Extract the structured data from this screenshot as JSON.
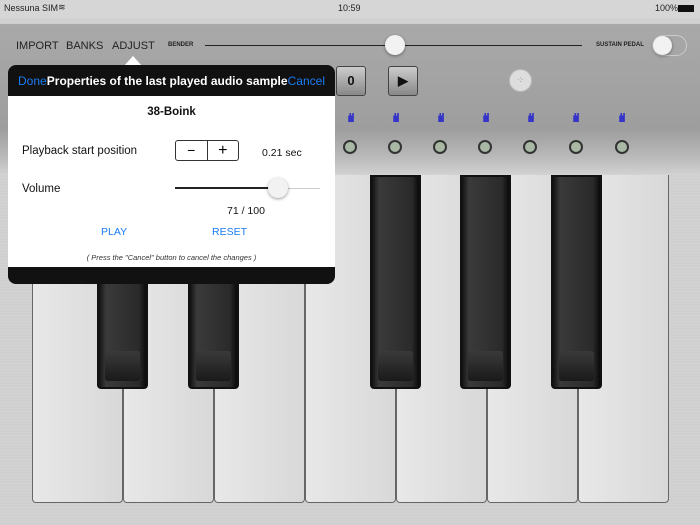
{
  "status": {
    "carrier": "Nessuna SIM",
    "time": "10:59",
    "battery": "100%"
  },
  "toolbar": {
    "import": "IMPORT",
    "banks": "BANKS",
    "adjust": "ADJUST",
    "bender": "BENDER",
    "sustain": "SUSTAIN PEDAL",
    "bender_value": 0.5,
    "sustain_on": false
  },
  "controls": {
    "counter": "0"
  },
  "popover": {
    "done": "Done",
    "title": "Properties of the last played audio sample",
    "cancel": "Cancel",
    "sample_name": "38-Boink",
    "playback_label": "Playback start position",
    "minus": "−",
    "plus": "+",
    "playback_value": "0.21 sec",
    "volume_label": "Volume",
    "volume_value": "71 / 100",
    "volume_fraction": 0.71,
    "play": "PLAY",
    "reset": "RESET",
    "hint": "( Press the \"Cancel\" button to cancel the changes )"
  }
}
